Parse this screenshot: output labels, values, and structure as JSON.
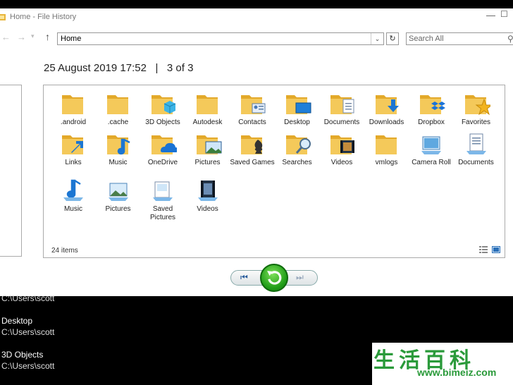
{
  "window": {
    "title": "Home - File History"
  },
  "nav": {
    "address": "Home",
    "search_placeholder": "Search All"
  },
  "snapshot": {
    "datetime": "25 August 2019 17:52",
    "separator": "|",
    "position": "3 of 3"
  },
  "main": {
    "item_count": "24 items",
    "items": [
      {
        "label": ".android",
        "icon": "folder-icon"
      },
      {
        "label": ".cache",
        "icon": "folder-icon"
      },
      {
        "label": "3D Objects",
        "icon": "3d-objects-folder-icon"
      },
      {
        "label": "Autodesk",
        "icon": "folder-icon"
      },
      {
        "label": "Contacts",
        "icon": "contacts-folder-icon"
      },
      {
        "label": "Desktop",
        "icon": "desktop-folder-icon"
      },
      {
        "label": "Documents",
        "icon": "documents-folder-icon"
      },
      {
        "label": "Downloads",
        "icon": "downloads-folder-icon"
      },
      {
        "label": "Dropbox",
        "icon": "dropbox-folder-icon"
      },
      {
        "label": "Favorites",
        "icon": "favorites-folder-icon"
      },
      {
        "label": "Links",
        "icon": "links-folder-icon"
      },
      {
        "label": "Music",
        "icon": "music-folder-icon"
      },
      {
        "label": "OneDrive",
        "icon": "onedrive-folder-icon"
      },
      {
        "label": "Pictures",
        "icon": "pictures-folder-icon"
      },
      {
        "label": "Saved Games",
        "icon": "saved-games-folder-icon"
      },
      {
        "label": "Searches",
        "icon": "searches-folder-icon"
      },
      {
        "label": "Videos",
        "icon": "videos-folder-icon"
      },
      {
        "label": "vmlogs",
        "icon": "folder-icon"
      },
      {
        "label": "Camera Roll",
        "icon": "camera-roll-library-icon"
      },
      {
        "label": "Documents",
        "icon": "documents-library-icon"
      },
      {
        "label": "Music",
        "icon": "music-library-icon"
      },
      {
        "label": "Pictures",
        "icon": "pictures-library-icon"
      },
      {
        "label": "Saved Pictures",
        "icon": "saved-pictures-library-icon"
      },
      {
        "label": "Videos",
        "icon": "videos-library-icon"
      }
    ]
  },
  "playback": {
    "prev": "previous-version-icon",
    "restore": "restore-icon",
    "next": "next-version-icon"
  },
  "list": [
    {
      "path": "C:\\Users\\scott"
    },
    {
      "name": "Desktop",
      "path": "C:\\Users\\scott"
    },
    {
      "name": "3D Objects",
      "path": "C:\\Users\\scott"
    }
  ],
  "watermark": {
    "chars": "生活百科",
    "url": "www.bimeiz.com"
  },
  "colors": {
    "folder": "#f4c95a",
    "folder_dark": "#e3a92a",
    "restore_green": "#1f9d17",
    "accent_blue": "#2a5d9c"
  }
}
